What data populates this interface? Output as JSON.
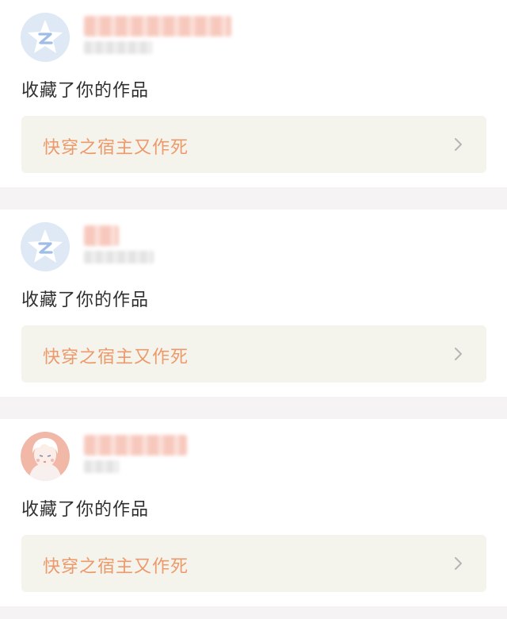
{
  "notifications": [
    {
      "avatar": "qzone-star-icon",
      "action_text": "收藏了你的作品",
      "work_title": "快穿之宿主又作死",
      "chevron": "chevron-right-icon"
    },
    {
      "avatar": "qzone-star-icon",
      "action_text": "收藏了你的作品",
      "work_title": "快穿之宿主又作死",
      "chevron": "chevron-right-icon"
    },
    {
      "avatar": "anime-portrait-avatar",
      "action_text": "收藏了你的作品",
      "work_title": "快穿之宿主又作死",
      "chevron": "chevron-right-icon"
    }
  ],
  "colors": {
    "page_background": "#f5f3f4",
    "card_background": "#ffffff",
    "work_box_background": "#f4f3ec",
    "work_title": "#ec9a6b",
    "action_text": "#2f2f2f",
    "avatar_background": "#dfe9f5"
  }
}
